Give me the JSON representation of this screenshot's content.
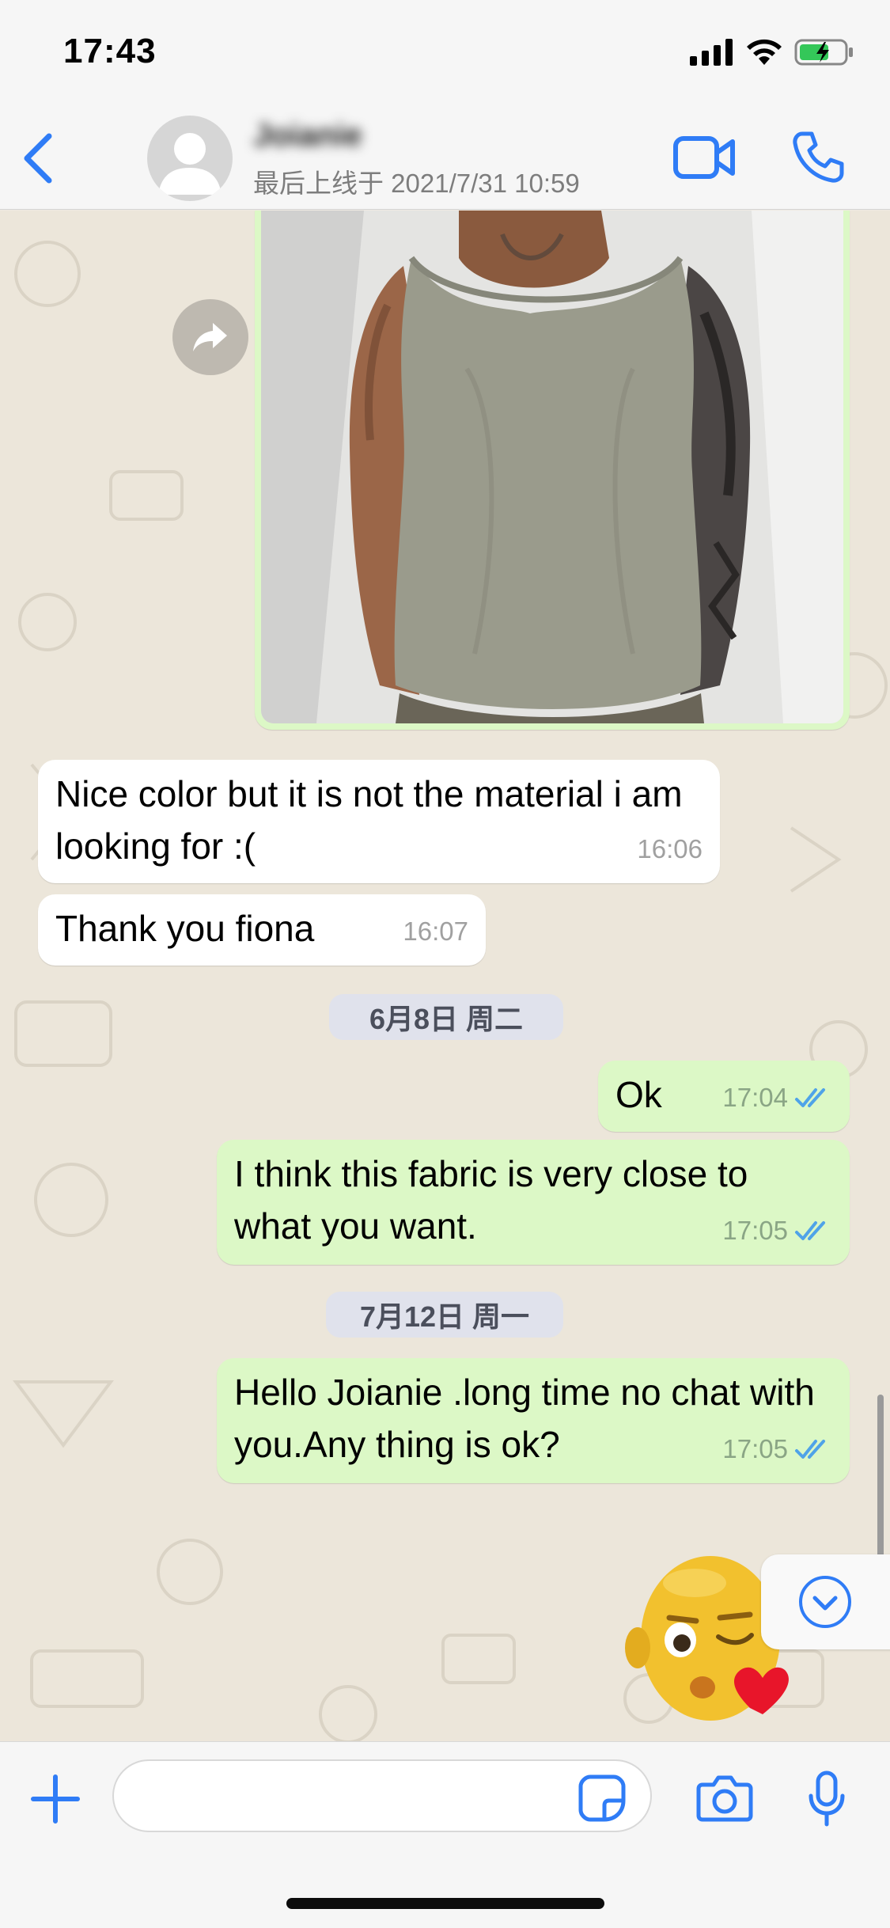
{
  "status_bar": {
    "time": "17:43",
    "icons": [
      "signal-icon",
      "wifi-icon",
      "battery-charging-icon"
    ]
  },
  "header": {
    "contact_name": "Joianie",
    "last_seen": "最后上线于 2021/7/31 10:59",
    "accent_color": "#2f7cf6"
  },
  "messages": [
    {
      "type": "image",
      "direction": "outgoing",
      "description_icon": "tank-top-photo"
    },
    {
      "type": "text",
      "direction": "incoming",
      "text": "Nice color but it is not the material i am looking for :(",
      "time": "16:06"
    },
    {
      "type": "text",
      "direction": "incoming",
      "text": "Thank you fiona",
      "time": "16:07"
    },
    {
      "type": "date",
      "text": "6月8日 周二"
    },
    {
      "type": "text",
      "direction": "outgoing",
      "text": "Ok",
      "time": "17:04",
      "status": "read"
    },
    {
      "type": "text",
      "direction": "outgoing",
      "text": "I think this fabric is very close to what you want.",
      "time": "17:05",
      "status": "read"
    },
    {
      "type": "date",
      "text": "7月12日 周一"
    },
    {
      "type": "text",
      "direction": "outgoing",
      "text": "Hello Joianie .long time no chat with you.Any thing is ok?",
      "time": "17:05",
      "status": "read"
    }
  ],
  "colors": {
    "incoming_bubble": "#ffffff",
    "outgoing_bubble": "#dcf8c6",
    "read_ticks": "#4fa3e8",
    "chat_background": "#ece6da"
  },
  "input": {
    "value": "",
    "placeholder": ""
  }
}
